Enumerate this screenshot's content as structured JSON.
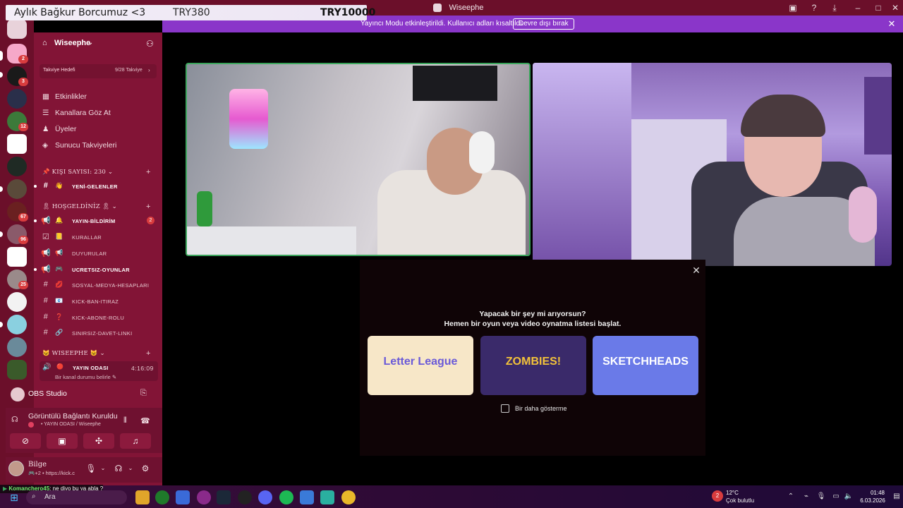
{
  "window": {
    "title": "Wiseephe"
  },
  "goal_overlay": {
    "title": "Aylık Bağkur Borcumuz <3",
    "current": "TRY380",
    "target": "TRY10000"
  },
  "streamer_banner": {
    "text": "Yayıncı Modu etkinleştirildi. Kullanıcı adları kısaltıldı.",
    "button": "Devre dışı bırak",
    "close_icon": "✕"
  },
  "server_rail": {
    "badges": [
      "2",
      "3",
      "12",
      "67",
      "96",
      "25"
    ]
  },
  "guild": {
    "name": "Wiseephe",
    "boost": {
      "label": "Takviye Hedefi",
      "count": "9/28 Takviye"
    },
    "nav": [
      {
        "label": "Etkinlikler",
        "icon": "▦"
      },
      {
        "label": "Kanallara Göz At",
        "icon": "☰"
      },
      {
        "label": "Üyeler",
        "icon": "♟"
      },
      {
        "label": "Sunucu Takviyeleri",
        "icon": "◈"
      }
    ],
    "categories": [
      {
        "name": "📌 KIŞI SAYISI: 230 ⌄"
      },
      {
        "name": "🎗 HOŞGELDİNİZ 🎗 ⌄"
      },
      {
        "name": "😺 WISEEPHE 😺 ⌄"
      }
    ],
    "channels": [
      {
        "icon": "#",
        "emoji": "👋",
        "name": "YENİ-GELENLER",
        "bold": true
      },
      {
        "icon": "📢",
        "emoji": "🔔",
        "name": "YAYIN-BİLDİRİM",
        "bold": true,
        "badge": "2"
      },
      {
        "icon": "☑",
        "emoji": "📒",
        "name": "KURALLAR",
        "bold": false
      },
      {
        "icon": "📢",
        "emoji": "📢",
        "name": "DUYURULAR",
        "bold": false
      },
      {
        "icon": "📢",
        "emoji": "🎮",
        "name": "UCRETSIZ-OYUNLAR",
        "bold": true
      },
      {
        "icon": "#",
        "emoji": "💋",
        "name": "SOSYAL-MEDYA-HESAPLARI",
        "bold": false
      },
      {
        "icon": "#",
        "emoji": "📧",
        "name": "KICK-BAN-ITIRAZ",
        "bold": false
      },
      {
        "icon": "#",
        "emoji": "❓",
        "name": "KICK-ABONE-ROLU",
        "bold": false
      },
      {
        "icon": "#",
        "emoji": "🔗",
        "name": "SINIRSIZ-DAVET-LINKI",
        "bold": false
      }
    ],
    "voice_channel": {
      "emoji": "🔴",
      "name": "YAYIN ODASI",
      "time": "4:16:09",
      "status": "Bir kanal durumu belirle ✎"
    }
  },
  "panels": {
    "obs": "OBS Studio",
    "rtc": {
      "title": "Görüntülü Bağlantı Kuruldu",
      "sub": "• YAYIN ODASI / Wiseephe"
    },
    "user": {
      "name": "Bilge",
      "sub": "🎮+2 • https://kick.c"
    }
  },
  "activity": {
    "question": "Yapacak bir şey mi arıyorsun?",
    "subtitle": "Hemen bir oyun veya video oynatma listesi başlat.",
    "cards": [
      {
        "label": "Letter League",
        "bg": "#f7e7c8",
        "fg": "#6a5ad8"
      },
      {
        "label": "ZOMBIES!",
        "bg": "#3a2a6a",
        "fg": "#f2c23a"
      },
      {
        "label": "SKETCHHEADS",
        "bg": "#6a7ae8",
        "fg": "#ffffff"
      }
    ],
    "checkbox_label": "Bir daha gösterme"
  },
  "chat_overlay": {
    "user": "Komanchero45",
    "message": ": ne diyo bu ya abla ?"
  },
  "taskbar": {
    "search": "Ara",
    "weather_temp": "12°C",
    "weather_desc": "Çok bulutlu",
    "weather_badge": "2",
    "time": "01:48",
    "date": "6.03.2026"
  },
  "colors": {
    "sidebar": "#821436",
    "rail": "#6b0f2a",
    "banner": "#8a36c9",
    "speaking_border": "#3ba55c"
  }
}
